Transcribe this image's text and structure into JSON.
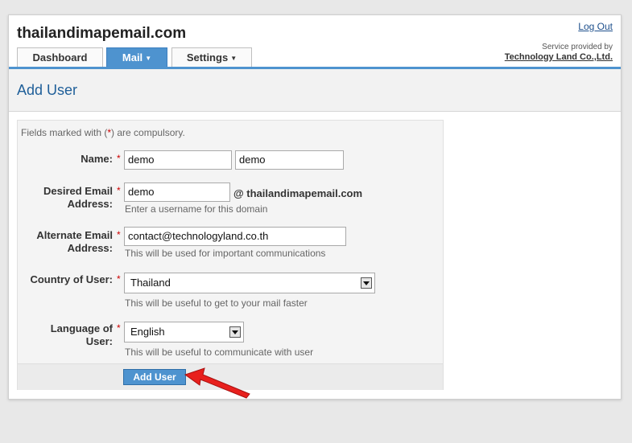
{
  "header": {
    "site_title": "thailandimapemail.com",
    "logout_label": "Log Out",
    "provider_text": "Service provided by",
    "provider_company": "Technology Land Co.,Ltd."
  },
  "tabs": [
    {
      "label": "Dashboard",
      "active": false,
      "has_dropdown": false
    },
    {
      "label": "Mail",
      "active": true,
      "has_dropdown": true
    },
    {
      "label": "Settings",
      "active": false,
      "has_dropdown": true
    }
  ],
  "page_title": "Add User",
  "form": {
    "note_prefix": "Fields marked with (",
    "note_star": "*",
    "note_suffix": ") are compulsory.",
    "name": {
      "label": "Name:",
      "first_value": "demo",
      "last_value": "demo"
    },
    "email": {
      "label_line1": "Desired Email",
      "label_line2": "Address:",
      "value": "demo",
      "domain": "@ thailandimapemail.com",
      "help": "Enter a username for this domain"
    },
    "alt_email": {
      "label_line1": "Alternate Email",
      "label_line2": "Address:",
      "value": "contact@technologyland.co.th",
      "help": "This will be used for important communications"
    },
    "country": {
      "label": "Country of User:",
      "value": "Thailand",
      "help": "This will be useful to get to your mail faster"
    },
    "language": {
      "label_line1": "Language of",
      "label_line2": "User:",
      "value": "English",
      "help": "This will be useful to communicate with user"
    },
    "required_marker": "*",
    "submit_label": "Add User"
  },
  "colors": {
    "accent": "#4e93cf",
    "title": "#1f5f99",
    "required": "#cc0000",
    "annotation_arrow": "#e8201d"
  }
}
